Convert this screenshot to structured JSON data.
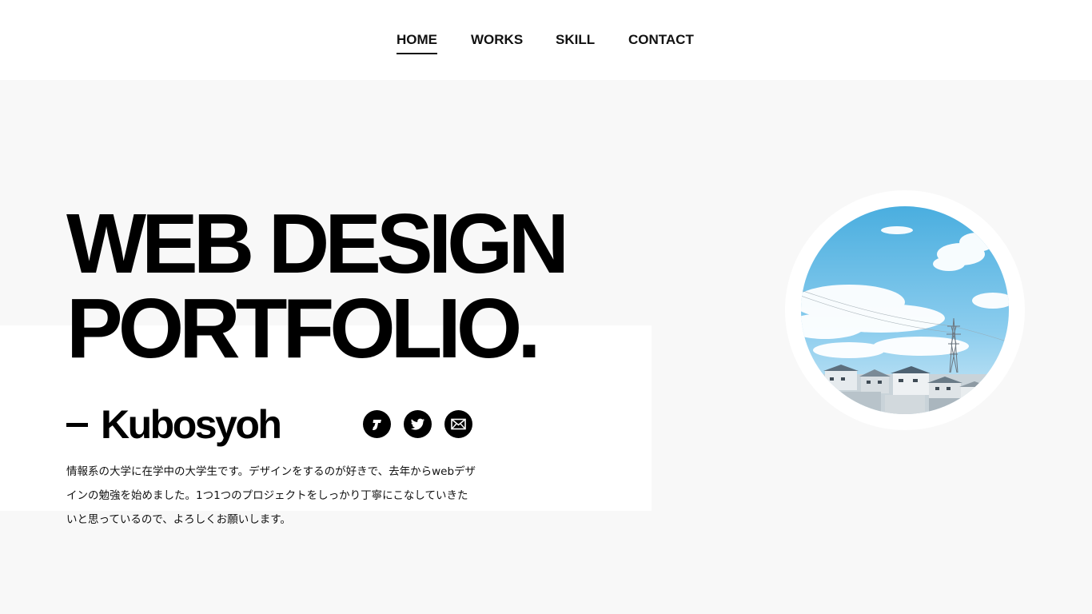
{
  "nav": {
    "items": [
      {
        "label": "HOME",
        "active": true
      },
      {
        "label": "WORKS",
        "active": false
      },
      {
        "label": "SKILL",
        "active": false
      },
      {
        "label": "CONTACT",
        "active": false
      }
    ]
  },
  "hero": {
    "title_line1": "WEB DESIGN",
    "title_line2": "PORTFOLIO.",
    "name": "Kubosyoh",
    "description_lines": [
      "情報系の大学に在学中の大学生です。デザインをするのが好きで、去年からwebデザ",
      "インの勉強を始めました。1つ1つのプロジェクトをしっかり丁寧にこなしていきた",
      "いと思っているので、よろしくお願いします。"
    ]
  },
  "social": [
    {
      "icon": "j-brand-icon"
    },
    {
      "icon": "twitter-bird-icon"
    },
    {
      "icon": "mail-icon"
    }
  ],
  "profile_photo": {
    "subject": "sky-clouds-houses-power-tower"
  },
  "colors": {
    "background": "#f8f8f8",
    "panel": "#ffffff",
    "text": "#000000",
    "sky": "#5bb4e0"
  }
}
